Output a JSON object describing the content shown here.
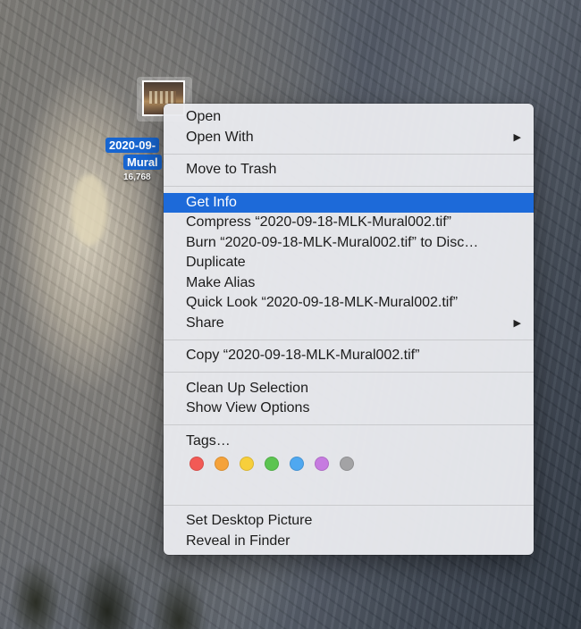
{
  "desktop_icon": {
    "name_line1": "2020-09-",
    "name_line2": "Mural",
    "size_text": "16,768"
  },
  "menu": {
    "group1": [
      {
        "label": "Open",
        "submenu": false
      },
      {
        "label": "Open With",
        "submenu": true
      }
    ],
    "group2": [
      {
        "label": "Move to Trash",
        "submenu": false
      }
    ],
    "group3": [
      {
        "label": "Get Info",
        "selected": true
      },
      {
        "label": "Compress “2020-09-18-MLK-Mural002.tif”"
      },
      {
        "label": "Burn “2020-09-18-MLK-Mural002.tif” to Disc…"
      },
      {
        "label": "Duplicate"
      },
      {
        "label": "Make Alias"
      },
      {
        "label": "Quick Look “2020-09-18-MLK-Mural002.tif”"
      },
      {
        "label": "Share",
        "submenu": true
      }
    ],
    "group4": [
      {
        "label": "Copy “2020-09-18-MLK-Mural002.tif”"
      }
    ],
    "group5": [
      {
        "label": "Clean Up Selection"
      },
      {
        "label": "Show View Options"
      }
    ],
    "group6": {
      "tags_label": "Tags…",
      "tag_colors": [
        "#f25a55",
        "#f5a23a",
        "#f7cf3b",
        "#5cc451",
        "#4fa8f0",
        "#c67be0",
        "#a3a3a5"
      ],
      "tag_names": [
        "red-tag",
        "orange-tag",
        "yellow-tag",
        "green-tag",
        "blue-tag",
        "purple-tag",
        "gray-tag"
      ]
    },
    "group7": [
      {
        "label": "Set Desktop Picture"
      },
      {
        "label": "Reveal in Finder"
      }
    ],
    "submenu_arrow": "▶"
  }
}
